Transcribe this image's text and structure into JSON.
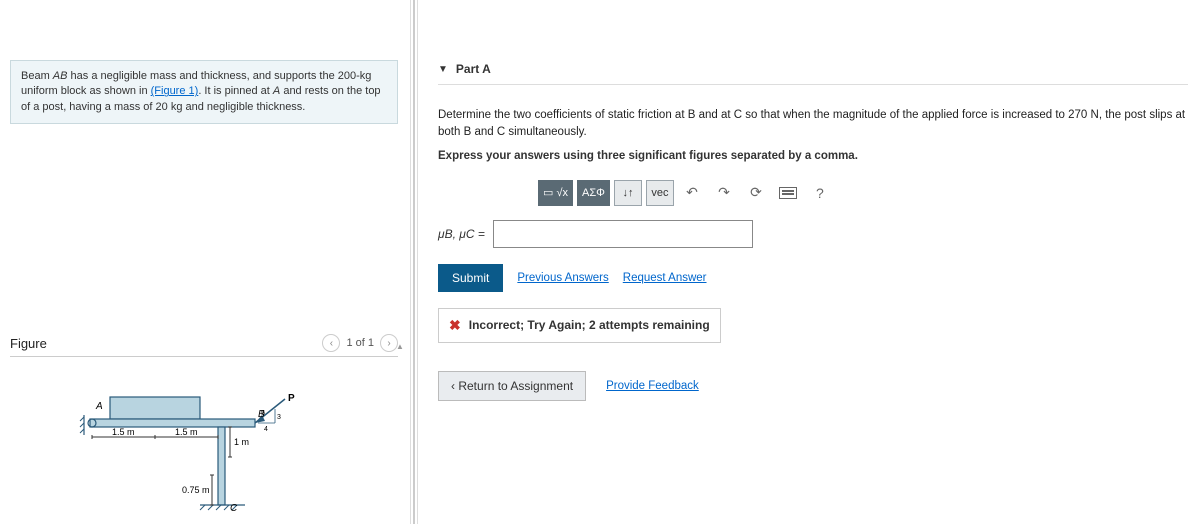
{
  "problem": {
    "text_prefix": "Beam ",
    "beam": "AB",
    "text_mid1": " has a negligible mass and thickness, and supports the ",
    "mass_block": "200-kg",
    "text_mid2": " uniform block as shown in ",
    "fig_link": "(Figure 1)",
    "text_mid3": ". It is pinned at ",
    "ptA": "A",
    "text_mid4": " and rests on the top of a post, having a mass of ",
    "mass_post": "20 kg",
    "text_end": " and negligible thickness."
  },
  "figure": {
    "title": "Figure",
    "pager": "1 of 1",
    "labels": {
      "A": "A",
      "B": "B",
      "C": "C",
      "P": "P",
      "d1": "1.5 m",
      "d2": "1.5 m",
      "d3": "1 m",
      "d4": "0.75 m",
      "r1": "5",
      "r2": "4",
      "r3": "3"
    }
  },
  "part": {
    "label": "Part A",
    "q_prefix": "Determine the two coefficients of static friction at ",
    "B": "B",
    "q_mid1": " and at ",
    "C": "C",
    "q_mid2": " so that when the magnitude of the applied force is increased to ",
    "force": "270 N",
    "q_mid3": ", the post slips at both ",
    "q_end": " simultaneously.",
    "instruction": "Express your answers using three significant figures separated by a comma."
  },
  "toolbar": {
    "templates": "▭",
    "sqrt": "√x",
    "greek": "ΑΣΦ",
    "sort": "↓↑",
    "vec": "vec",
    "undo": "↶",
    "redo": "↷",
    "reset": "⟳",
    "help": "?"
  },
  "answer": {
    "label": "μB, μC =",
    "value": ""
  },
  "actions": {
    "submit": "Submit",
    "previous": "Previous Answers",
    "request": "Request Answer"
  },
  "feedback": {
    "text": "Incorrect; Try Again; 2 attempts remaining"
  },
  "footer": {
    "return": "Return to Assignment",
    "provide": "Provide Feedback"
  }
}
